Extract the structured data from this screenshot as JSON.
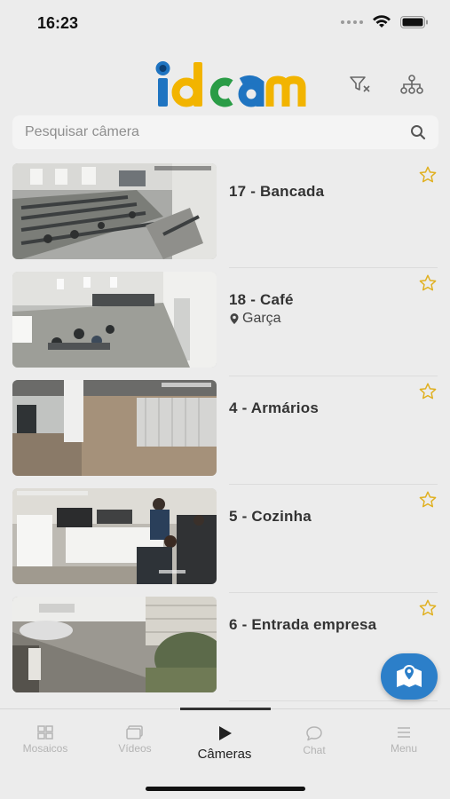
{
  "status_bar": {
    "time": "16:23"
  },
  "header": {
    "logo_text": "idcam",
    "logo_colors": {
      "i": "#1f74c1",
      "d": "#f2b400",
      "c": "#2a9c46",
      "a": "#1f74c1",
      "m": "#f2b400"
    },
    "filter_clear_icon": "filter-x-icon",
    "hierarchy_icon": "hierarchy-icon"
  },
  "search": {
    "placeholder": "Pesquisar câmera",
    "value": ""
  },
  "cameras": [
    {
      "name": "17 - Bancada",
      "location": "",
      "favorite": false
    },
    {
      "name": "18 - Café",
      "location": "Garça",
      "favorite": false
    },
    {
      "name": "4 - Armários",
      "location": "",
      "favorite": false
    },
    {
      "name": "5 - Cozinha",
      "location": "",
      "favorite": false
    },
    {
      "name": "6 - Entrada empresa",
      "location": "",
      "favorite": false
    }
  ],
  "fab": {
    "icon": "map-pin-icon"
  },
  "tabs": [
    {
      "label": "Mosaicos",
      "icon": "grid-icon",
      "active": false
    },
    {
      "label": "Vídeos",
      "icon": "video-icon",
      "active": false
    },
    {
      "label": "Câmeras",
      "icon": "play-icon",
      "active": true
    },
    {
      "label": "Chat",
      "icon": "chat-icon",
      "active": false
    },
    {
      "label": "Menu",
      "icon": "menu-icon",
      "active": false
    }
  ],
  "colors": {
    "accent": "#2c7fc9",
    "star": "#e0b020",
    "background": "#ececec"
  }
}
